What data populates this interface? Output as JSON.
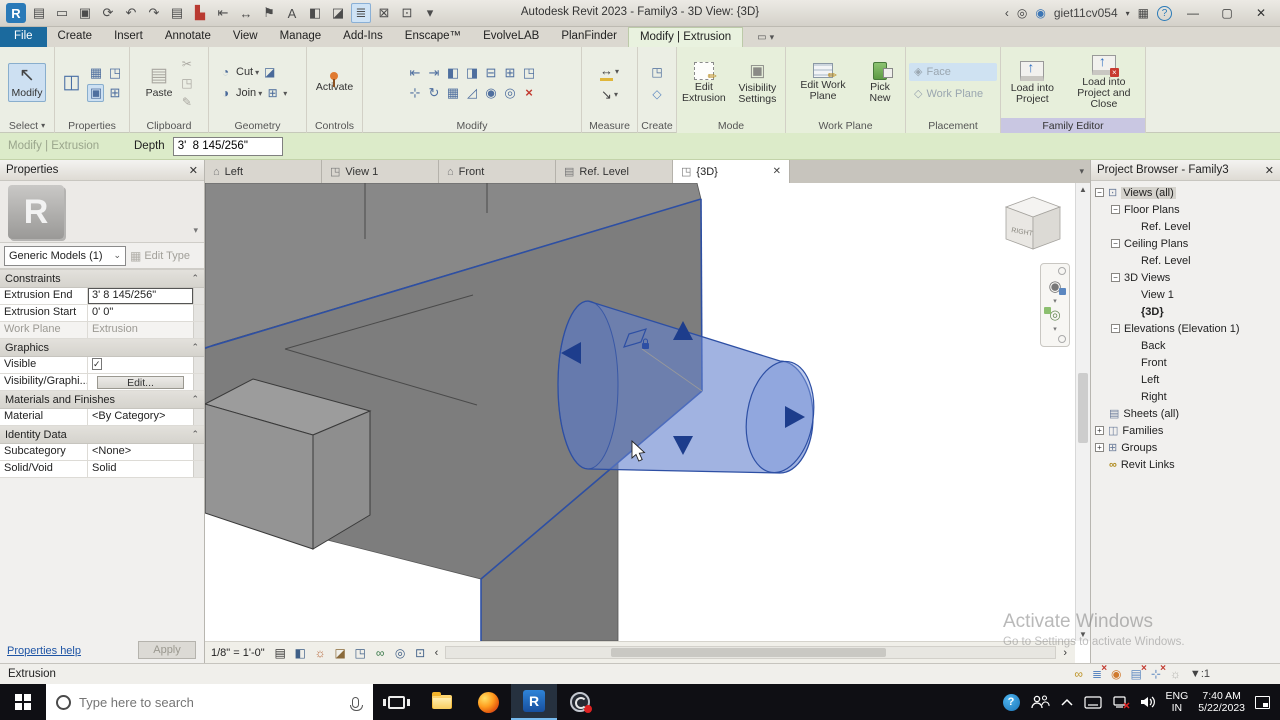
{
  "title_bar": {
    "title": "Autodesk Revit 2023 - Family3 - 3D View: {3D}",
    "user": "giet11cv054",
    "qat": [
      {
        "name": "revit-app",
        "glyph": "R"
      },
      {
        "name": "ui-views",
        "glyph": "▤"
      },
      {
        "name": "open",
        "glyph": "▭"
      },
      {
        "name": "save",
        "glyph": "▣"
      },
      {
        "name": "sync",
        "glyph": "⟳"
      },
      {
        "name": "undo",
        "glyph": "↶"
      },
      {
        "name": "redo",
        "glyph": "↷"
      },
      {
        "name": "print",
        "glyph": "▤"
      },
      {
        "name": "export-pdf",
        "glyph": "▙"
      },
      {
        "name": "measure",
        "glyph": "⇤"
      },
      {
        "name": "aligned-dimension",
        "glyph": "↔"
      },
      {
        "name": "tag",
        "glyph": "⚑"
      },
      {
        "name": "text",
        "glyph": "A"
      },
      {
        "name": "default-3d-view",
        "glyph": "◧"
      },
      {
        "name": "section",
        "glyph": "◪"
      },
      {
        "name": "thin-lines",
        "glyph": "≣"
      },
      {
        "name": "close-hidden-windows",
        "glyph": "⊠"
      },
      {
        "name": "switch-windows",
        "glyph": "⊡"
      },
      {
        "name": "customize-qat",
        "glyph": "▾"
      }
    ],
    "search_glyph": "◎",
    "user_glyph": "◉",
    "cart_glyph": "▦",
    "help_glyph": "?",
    "back_glyph": "‹",
    "min_glyph": "—",
    "restore_glyph": "▢",
    "close_glyph": "✕"
  },
  "ribbon": {
    "tabs": [
      "File",
      "Create",
      "Insert",
      "Annotate",
      "View",
      "Manage",
      "Add-Ins",
      "Enscape™",
      "EvolveLAB",
      "PlanFinder",
      "Modify | Extrusion"
    ],
    "panels": [
      {
        "label": "Select",
        "buttons": [
          "Modify"
        ]
      },
      {
        "label": "Properties"
      },
      {
        "label": "Clipboard",
        "buttons": [
          "Paste"
        ]
      },
      {
        "label": "Geometry",
        "buttons": [
          "Cut",
          "Join"
        ]
      },
      {
        "label": "Controls",
        "buttons": [
          "Activate"
        ]
      },
      {
        "label": "Modify"
      },
      {
        "label": "Measure"
      },
      {
        "label": "Create"
      },
      {
        "label": "Mode",
        "buttons": [
          "Edit Extrusion",
          "Visibility Settings"
        ]
      },
      {
        "label": "Work Plane",
        "buttons": [
          "Edit Work Plane",
          "Pick New"
        ]
      },
      {
        "label": "Placement",
        "buttons": [
          "Face",
          "Work Plane"
        ]
      },
      {
        "label": "Family Editor",
        "buttons": [
          "Load into Project",
          "Load into Project and Close"
        ]
      }
    ]
  },
  "options_bar": {
    "context": "Modify | Extrusion",
    "depth_label": "Depth",
    "depth_value": "3'  8 145/256\""
  },
  "properties_palette": {
    "title": "Properties",
    "type_image_letter": "R",
    "type_selector": "Generic Models (1)",
    "edit_type_label": "Edit Type",
    "rows": [
      {
        "kind": "sec",
        "label": "Constraints"
      },
      {
        "kind": "val",
        "label": "Extrusion End",
        "value": "3'  8 145/256\""
      },
      {
        "kind": "val",
        "label": "Extrusion Start",
        "value": "0'  0\""
      },
      {
        "kind": "val",
        "label": "Work Plane",
        "value": "Extrusion"
      },
      {
        "kind": "sec",
        "label": "Graphics"
      },
      {
        "kind": "chk",
        "label": "Visible",
        "check_glyph": "✓"
      },
      {
        "kind": "btn",
        "label": "Visibility/Graphi...",
        "value": "Edit..."
      },
      {
        "kind": "sec",
        "label": "Materials and Finishes"
      },
      {
        "kind": "val",
        "label": "Material",
        "value": "<By Category>"
      },
      {
        "kind": "sec",
        "label": "Identity Data"
      },
      {
        "kind": "val",
        "label": "Subcategory",
        "value": "<None>"
      },
      {
        "kind": "val",
        "label": "Solid/Void",
        "value": "Solid"
      }
    ],
    "help_link": "Properties help",
    "apply_label": "Apply"
  },
  "view_tabs": {
    "tabs": [
      {
        "label": "Left",
        "icon": "⌂"
      },
      {
        "label": "View 1",
        "icon": "◳"
      },
      {
        "label": "Front",
        "icon": "⌂"
      },
      {
        "label": "Ref. Level",
        "icon": "▤"
      },
      {
        "label": "{3D}",
        "icon": "◳"
      }
    ]
  },
  "viewport": {
    "viewcube_face": "RIGHT",
    "scale": "1/8\" = 1'-0\"",
    "watermark_line1": "Activate Windows",
    "watermark_line2": "Go to Settings to activate Windows.",
    "vcb_icons": [
      {
        "name": "detail-level",
        "glyph": "▤"
      },
      {
        "name": "visual-style",
        "glyph": "◧"
      },
      {
        "name": "sun-path",
        "glyph": "☼"
      },
      {
        "name": "shadows",
        "glyph": "◪"
      },
      {
        "name": "show-rendering-dialog",
        "glyph": "◳"
      },
      {
        "name": "temporary-hide-isolate",
        "glyph": "∞"
      },
      {
        "name": "reveal-hidden-elements",
        "glyph": "◎"
      },
      {
        "name": "crop-region",
        "glyph": "⊡"
      }
    ]
  },
  "project_browser": {
    "title": "Project Browser - Family3",
    "items": [
      {
        "label": "Views (all)",
        "expand": "−",
        "icon": "⊡"
      },
      {
        "label": "Floor Plans",
        "expand": "−"
      },
      {
        "label": "Ref. Level"
      },
      {
        "label": "Ceiling Plans",
        "expand": "−"
      },
      {
        "label": "Ref. Level"
      },
      {
        "label": "3D Views",
        "expand": "−"
      },
      {
        "label": "View 1"
      },
      {
        "label": "{3D}"
      },
      {
        "label": "Elevations (Elevation 1)",
        "expand": "−"
      },
      {
        "label": "Back"
      },
      {
        "label": "Front"
      },
      {
        "label": "Left"
      },
      {
        "label": "Right"
      },
      {
        "label": "Sheets (all)",
        "icon": "▤"
      },
      {
        "label": "Families",
        "expand": "+",
        "icon": "◫"
      },
      {
        "label": "Groups",
        "expand": "+",
        "icon": "⊞"
      },
      {
        "label": "Revit Links",
        "icon": "∞"
      }
    ]
  },
  "status_bar": {
    "selection": "Extrusion",
    "filter_glyph": "▼",
    "filter_badge": ":1",
    "icons": [
      {
        "name": "editable-only",
        "glyph": "∞",
        "cls": "y"
      },
      {
        "name": "worksets-status",
        "glyph": "≣",
        "cls": "xm"
      },
      {
        "name": "pinned-elements",
        "glyph": "◉",
        "cls": "o"
      },
      {
        "name": "exclude-options",
        "glyph": "▤",
        "cls": "xm"
      },
      {
        "name": "press-drag",
        "glyph": "⊹",
        "cls": "xm"
      },
      {
        "name": "background-processes",
        "glyph": "☼",
        "cls": "gy"
      }
    ]
  },
  "taskbar": {
    "search_placeholder": "Type here to search",
    "revit_glyph": "R",
    "lang_line1": "ENG",
    "lang_line2": "IN",
    "time": "7:40 AM",
    "date": "5/22/2023",
    "apps": [
      "task-view",
      "file-explorer",
      "firefox",
      "revit",
      "obs-studio"
    ]
  }
}
